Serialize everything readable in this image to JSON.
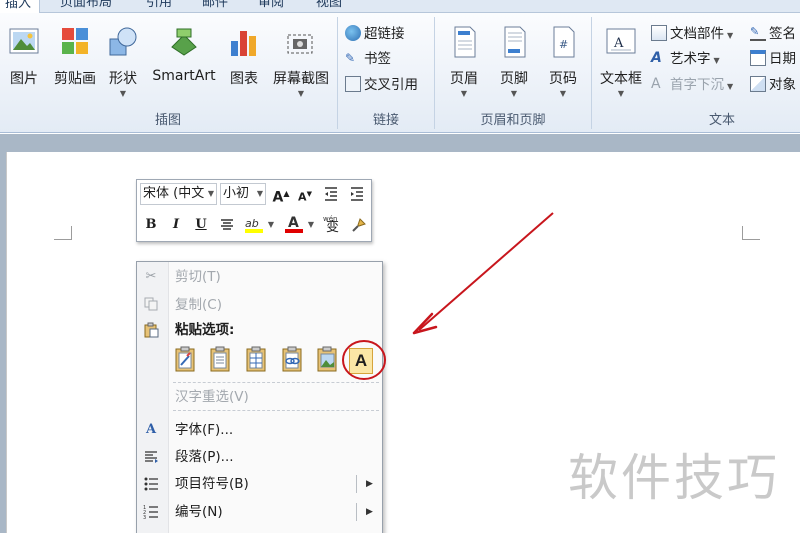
{
  "tabs": [
    "插入",
    "页面布局",
    "引用",
    "邮件",
    "审阅",
    "视图"
  ],
  "ribbon": {
    "groups": {
      "illustrations": "插图",
      "links": "链接",
      "header_footer": "页眉和页脚",
      "text": "文本"
    },
    "buttons": {
      "picture": "图片",
      "clipart": "剪贴画",
      "shapes": "形状",
      "smartart": "SmartArt",
      "chart": "图表",
      "screenshot": "屏幕截图",
      "hyperlink": "超链接",
      "bookmark": "书签",
      "crossref": "交叉引用",
      "header": "页眉",
      "footer": "页脚",
      "pagenum": "页码",
      "textbox": "文本框",
      "quickparts": "文档部件",
      "wordart": "艺术字",
      "dropcap": "首字下沉",
      "signature": "签名",
      "datetime": "日期",
      "object": "对象"
    }
  },
  "mini_toolbar": {
    "font_name": "宋体 (中文",
    "font_size": "小初",
    "grow": "A",
    "shrink": "A",
    "bold": "B",
    "italic": "I",
    "underline": "U",
    "highlight": "ab",
    "font_color": "A",
    "phonetic_top": "wén",
    "phonetic_char": "变"
  },
  "context_menu": {
    "cut": "剪切(T)",
    "copy": "复制(C)",
    "paste_header": "粘贴选项:",
    "reconvert": "汉字重选(V)",
    "font": "字体(F)...",
    "paragraph": "段落(P)...",
    "bullets": "项目符号(B)",
    "numbering": "编号(N)"
  },
  "icons": {
    "paste_keep_text": "A"
  },
  "colors": {
    "annotation": "#c8161d",
    "highlight": "#ffff00",
    "font_color": "#e00000"
  },
  "watermark": "软件技巧"
}
